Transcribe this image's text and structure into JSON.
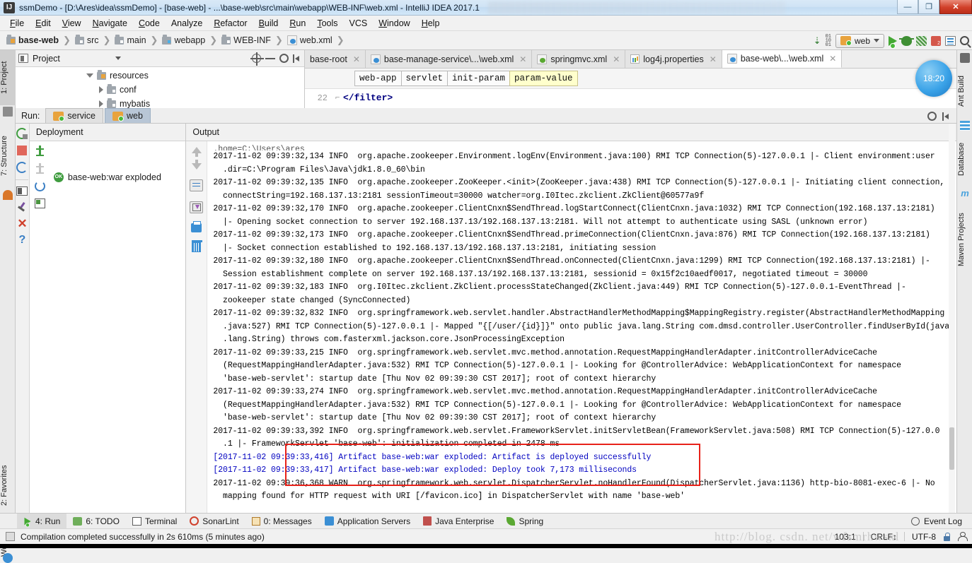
{
  "window": {
    "title": "ssmDemo - [D:\\Ares\\idea\\ssmDemo] - [base-web] - ...\\base-web\\src\\main\\webapp\\WEB-INF\\web.xml - IntelliJ IDEA 2017.1",
    "app_icon": "IJ",
    "minimize": "—",
    "maximize": "❐",
    "close": "✕"
  },
  "menu": {
    "items": [
      "File",
      "Edit",
      "View",
      "Navigate",
      "Code",
      "Analyze",
      "Refactor",
      "Build",
      "Run",
      "Tools",
      "VCS",
      "Window",
      "Help"
    ]
  },
  "navbar": {
    "crumbs": [
      {
        "label": "base-web",
        "icon": "module-folder-icon"
      },
      {
        "label": "src",
        "icon": "folder-icon"
      },
      {
        "label": "main",
        "icon": "folder-icon"
      },
      {
        "label": "webapp",
        "icon": "web-folder-icon"
      },
      {
        "label": "WEB-INF",
        "icon": "folder-icon"
      },
      {
        "label": "web.xml",
        "icon": "xml-file-icon"
      }
    ],
    "separator": "〉",
    "line_col_icon": "01 10 01",
    "run_config": "web",
    "icons": [
      "run-icon",
      "debug-icon",
      "coverage-icon",
      "stop-icon",
      "database-icon",
      "search-everywhere-icon"
    ]
  },
  "left_strip": {
    "items": [
      {
        "label": "1: Project",
        "icon": "project-icon",
        "selected": true
      },
      {
        "label": "7: Structure",
        "icon": "structure-icon",
        "selected": false
      },
      {
        "label": "2: Favorites",
        "icon": "favorites-star-icon",
        "selected": false
      },
      {
        "label": "Web",
        "icon": "web-globe-icon",
        "selected": false
      }
    ]
  },
  "right_strip": {
    "items": [
      {
        "label": "Ant Build",
        "icon": "ant-icon"
      },
      {
        "label": "Database",
        "icon": "database-icon"
      },
      {
        "label": "Maven Projects",
        "icon": "maven-m-icon"
      }
    ]
  },
  "project_panel": {
    "title": "Project",
    "header_icons": [
      "target-icon",
      "collapse-all-icon",
      "gear-icon",
      "hide-icon"
    ],
    "tree": [
      {
        "label": "resources",
        "indent": 1,
        "expanded": true,
        "icon": "resources-folder-icon"
      },
      {
        "label": "conf",
        "indent": 2,
        "expanded": false,
        "icon": "folder-icon"
      },
      {
        "label": "mybatis",
        "indent": 2,
        "expanded": false,
        "icon": "folder-icon"
      }
    ]
  },
  "editor": {
    "tabs": [
      {
        "label": "base-root",
        "icon": "none",
        "active": false
      },
      {
        "label": "base-manage-service\\...\\web.xml",
        "icon": "xml-file-icon",
        "active": false
      },
      {
        "label": "springmvc.xml",
        "icon": "xml-spring-icon",
        "active": false
      },
      {
        "label": "log4j.properties",
        "icon": "properties-file-icon",
        "active": false
      },
      {
        "label": "base-web\\...\\web.xml",
        "icon": "xml-file-icon",
        "active": true
      }
    ],
    "close_glyph": "✕",
    "breadcrumb": [
      {
        "label": "web-app",
        "highlight": false
      },
      {
        "label": "servlet",
        "highlight": false
      },
      {
        "label": "init-param",
        "highlight": false
      },
      {
        "label": "param-value",
        "highlight": true
      }
    ],
    "code": {
      "line_number": "22",
      "text": "</filter>"
    },
    "progress_badge": "18:20"
  },
  "run_window": {
    "label": "Run:",
    "tabs": [
      {
        "label": "service",
        "icon": "tomcat-icon",
        "active": false
      },
      {
        "label": "web",
        "icon": "tomcat-icon",
        "active": true
      }
    ],
    "toolbar_icons": [
      "rerun-icon",
      "stop-icon",
      "restart-icon",
      "layout-icon",
      "pin-icon",
      "close-icon",
      "help-icon"
    ],
    "deployment": {
      "header": "Deployment",
      "side_icons": [
        "redeploy-icon",
        "undeploy-icon",
        "update-icon",
        "deploy-icon"
      ],
      "artifact": "base-web:war exploded",
      "artifact_status": "OK"
    },
    "output": {
      "header": "Output",
      "side_icons": [
        "up-arrow-icon",
        "down-arrow-icon",
        "soft-wrap-icon",
        "scroll-to-end-icon",
        "print-icon",
        "clear-all-icon"
      ],
      "lines": [
        {
          "text": ".home=C:\\Users\\ares",
          "style": "clip"
        },
        {
          "text": "2017-11-02 09:39:32,134 INFO  org.apache.zookeeper.Environment.logEnv(Environment.java:100) RMI TCP Connection(5)-127.0.0.1 |- Client environment:user",
          "style": "normal"
        },
        {
          "text": "  .dir=C:\\Program Files\\Java\\jdk1.8.0_60\\bin",
          "style": "normal"
        },
        {
          "text": "2017-11-02 09:39:32,135 INFO  org.apache.zookeeper.ZooKeeper.<init>(ZooKeeper.java:438) RMI TCP Connection(5)-127.0.0.1 |- Initiating client connection,",
          "style": "normal"
        },
        {
          "text": "  connectString=192.168.137.13:2181 sessionTimeout=30000 watcher=org.I0Itec.zkclient.ZkClient@60577a9f",
          "style": "normal"
        },
        {
          "text": "2017-11-02 09:39:32,170 INFO  org.apache.zookeeper.ClientCnxn$SendThread.logStartConnect(ClientCnxn.java:1032) RMI TCP Connection(192.168.137.13:2181)",
          "style": "normal"
        },
        {
          "text": "  |- Opening socket connection to server 192.168.137.13/192.168.137.13:2181. Will not attempt to authenticate using SASL (unknown error)",
          "style": "normal"
        },
        {
          "text": "2017-11-02 09:39:32,173 INFO  org.apache.zookeeper.ClientCnxn$SendThread.primeConnection(ClientCnxn.java:876) RMI TCP Connection(192.168.137.13:2181)",
          "style": "normal"
        },
        {
          "text": "  |- Socket connection established to 192.168.137.13/192.168.137.13:2181, initiating session",
          "style": "normal"
        },
        {
          "text": "2017-11-02 09:39:32,180 INFO  org.apache.zookeeper.ClientCnxn$SendThread.onConnected(ClientCnxn.java:1299) RMI TCP Connection(192.168.137.13:2181) |-",
          "style": "normal"
        },
        {
          "text": "  Session establishment complete on server 192.168.137.13/192.168.137.13:2181, sessionid = 0x15f2c10aedf0017, negotiated timeout = 30000",
          "style": "normal"
        },
        {
          "text": "2017-11-02 09:39:32,183 INFO  org.I0Itec.zkclient.ZkClient.processStateChanged(ZkClient.java:449) RMI TCP Connection(5)-127.0.0.1-EventThread |-",
          "style": "normal"
        },
        {
          "text": "  zookeeper state changed (SyncConnected)",
          "style": "normal"
        },
        {
          "text": "2017-11-02 09:39:32,832 INFO  org.springframework.web.servlet.handler.AbstractHandlerMethodMapping$MappingRegistry.register(AbstractHandlerMethodMapping",
          "style": "normal"
        },
        {
          "text": "  .java:527) RMI TCP Connection(5)-127.0.0.1 |- Mapped \"{[/user/{id}]}\" onto public java.lang.String com.dmsd.controller.UserController.findUserById(java",
          "style": "normal"
        },
        {
          "text": "  .lang.String) throws com.fasterxml.jackson.core.JsonProcessingException",
          "style": "normal"
        },
        {
          "text": "2017-11-02 09:39:33,215 INFO  org.springframework.web.servlet.mvc.method.annotation.RequestMappingHandlerAdapter.initControllerAdviceCache",
          "style": "normal"
        },
        {
          "text": "  (RequestMappingHandlerAdapter.java:532) RMI TCP Connection(5)-127.0.0.1 |- Looking for @ControllerAdvice: WebApplicationContext for namespace",
          "style": "normal"
        },
        {
          "text": "  'base-web-servlet': startup date [Thu Nov 02 09:39:30 CST 2017]; root of context hierarchy",
          "style": "normal"
        },
        {
          "text": "2017-11-02 09:39:33,274 INFO  org.springframework.web.servlet.mvc.method.annotation.RequestMappingHandlerAdapter.initControllerAdviceCache",
          "style": "normal"
        },
        {
          "text": "  (RequestMappingHandlerAdapter.java:532) RMI TCP Connection(5)-127.0.0.1 |- Looking for @ControllerAdvice: WebApplicationContext for namespace",
          "style": "normal"
        },
        {
          "text": "  'base-web-servlet': startup date [Thu Nov 02 09:39:30 CST 2017]; root of context hierarchy",
          "style": "normal"
        },
        {
          "text": "2017-11-02 09:39:33,392 INFO  org.springframework.web.servlet.FrameworkServlet.initServletBean(FrameworkServlet.java:508) RMI TCP Connection(5)-127.0.0",
          "style": "normal"
        },
        {
          "text": "  .1 |- FrameworkServlet 'base-web': initialization completed in 2478 ms",
          "style": "normal"
        },
        {
          "text": "[2017-11-02 09:39:33,416] Artifact base-web:war exploded: Artifact is deployed successfully",
          "style": "blue"
        },
        {
          "text": "[2017-11-02 09:39:33,417] Artifact base-web:war exploded: Deploy took 7,173 milliseconds",
          "style": "blue"
        },
        {
          "text": "2017-11-02 09:39:36,368 WARN  org.springframework.web.servlet.DispatcherServlet.noHandlerFound(DispatcherServlet.java:1136) http-bio-8081-exec-6 |- No",
          "style": "normal"
        },
        {
          "text": "  mapping found for HTTP request with URI [/favicon.ico] in DispatcherServlet with name 'base-web'",
          "style": "normal"
        }
      ]
    }
  },
  "status_tabs": {
    "items": [
      {
        "label": "4: Run",
        "icon": "run-icon",
        "selected": true
      },
      {
        "label": "6: TODO",
        "icon": "todo-icon",
        "selected": false
      },
      {
        "label": "Terminal",
        "icon": "terminal-icon",
        "selected": false
      },
      {
        "label": "SonarLint",
        "icon": "sonarlint-icon",
        "selected": false
      },
      {
        "label": "0: Messages",
        "icon": "messages-icon",
        "selected": false
      },
      {
        "label": "Application Servers",
        "icon": "app-servers-icon",
        "selected": false
      },
      {
        "label": "Java Enterprise",
        "icon": "java-enterprise-icon",
        "selected": false
      },
      {
        "label": "Spring",
        "icon": "spring-leaf-icon",
        "selected": false
      }
    ],
    "event_log": "Event Log"
  },
  "status_bar": {
    "message": "Compilation completed successfully in 2s 610ms (5 minutes ago)",
    "caret": "103:1",
    "line_separator": "CRLF↕",
    "encoding": "UTF-8",
    "lock_icon": "lock-icon",
    "inspection_icon": "hector-icon"
  },
  "watermark": {
    "text": "http://blog. csdn. net/wfsmrhwsxl"
  }
}
